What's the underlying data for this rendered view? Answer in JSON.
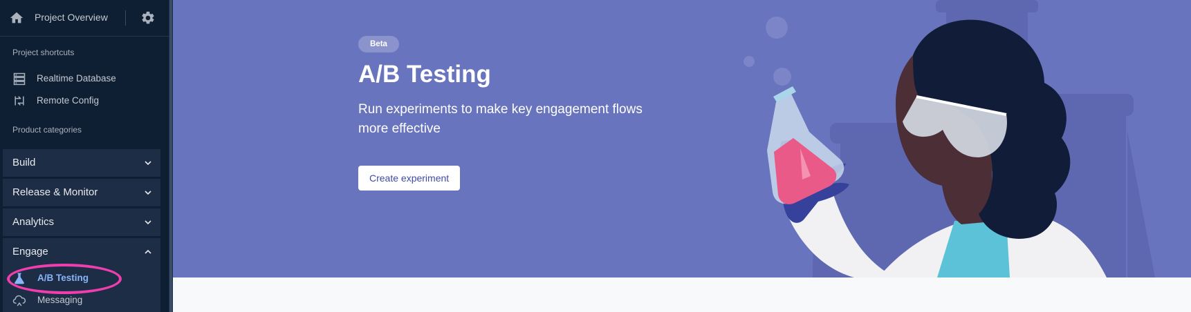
{
  "topbar": {
    "overview_label": "Project Overview"
  },
  "shortcuts": {
    "caption": "Project shortcuts",
    "items": [
      {
        "label": "Realtime Database",
        "icon": "database-icon"
      },
      {
        "label": "Remote Config",
        "icon": "remote-config-icon"
      }
    ]
  },
  "categories": {
    "caption": "Product categories",
    "items": [
      {
        "label": "Build",
        "expanded": false
      },
      {
        "label": "Release & Monitor",
        "expanded": false
      },
      {
        "label": "Analytics",
        "expanded": false
      },
      {
        "label": "Engage",
        "expanded": true
      }
    ],
    "engage_items": [
      {
        "label": "A/B Testing",
        "icon": "flask-icon",
        "active": true
      },
      {
        "label": "Messaging",
        "icon": "messaging-icon",
        "active": false
      }
    ]
  },
  "hero": {
    "badge": "Beta",
    "title": "A/B Testing",
    "subtitle": "Run experiments to make key engagement flows more effective",
    "cta_label": "Create experiment"
  },
  "colors": {
    "sidebar_bg": "#0f1f33",
    "hero_bg": "#6874bd",
    "active_accent": "#8ab4f8",
    "highlight_ring": "#ef3eae"
  }
}
